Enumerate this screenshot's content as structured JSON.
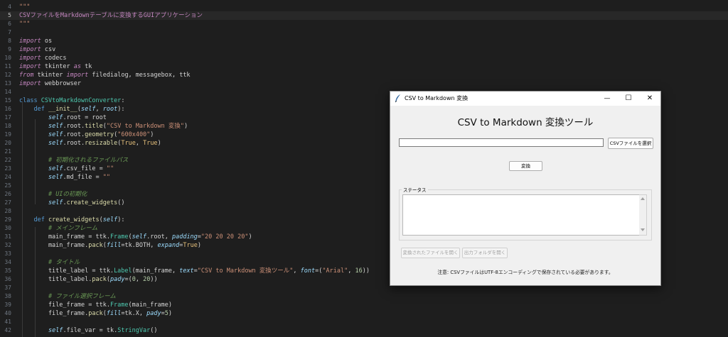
{
  "editor": {
    "lines": [
      {
        "n": "4",
        "html": "<span class='s'>\"\"\"</span>"
      },
      {
        "n": "5",
        "html": "<span class='d'>CSVファイルをMarkdownテーブルに変換するGUIアプリケーション</span>"
      },
      {
        "n": "6",
        "html": "<span class='s'>\"\"\"</span>"
      },
      {
        "n": "7",
        "html": ""
      },
      {
        "n": "8",
        "html": "<span class='k'>import</span><span class='t'> os</span>"
      },
      {
        "n": "9",
        "html": "<span class='k'>import</span><span class='t'> csv</span>"
      },
      {
        "n": "10",
        "html": "<span class='k'>import</span><span class='t'> codecs</span>"
      },
      {
        "n": "11",
        "html": "<span class='k'>import</span><span class='t'> tkinter </span><span class='k'>as</span><span class='t'> tk</span>"
      },
      {
        "n": "12",
        "html": "<span class='k'>from</span><span class='t'> tkinter </span><span class='k'>import</span><span class='t'> filedialog, messagebox, ttk</span>"
      },
      {
        "n": "13",
        "html": "<span class='k'>import</span><span class='t'> webbrowser</span>"
      },
      {
        "n": "14",
        "html": ""
      },
      {
        "n": "15",
        "html": "<span class='kw'>class</span><span class='t'> </span><span class='cl'>CSVtoMarkdownConverter</span><span class='t'>:</span>"
      },
      {
        "n": "16",
        "html": "<span class='t'>    </span><span class='kw'>def</span><span class='t'> </span><span class='f'>__init__</span><span class='t'>(</span><span class='p'>self</span><span class='t'>, </span><span class='p'>root</span><span class='t'>):</span>"
      },
      {
        "n": "17",
        "html": "<span class='t'>        </span><span class='p'>self</span><span class='t'>.root = root</span>"
      },
      {
        "n": "18",
        "html": "<span class='t'>        </span><span class='p'>self</span><span class='t'>.root.</span><span class='f'>title</span><span class='t'>(</span><span class='s'>\"CSV to Markdown 変換\"</span><span class='t'>)</span>"
      },
      {
        "n": "19",
        "html": "<span class='t'>        </span><span class='p'>self</span><span class='t'>.root.</span><span class='f'>geometry</span><span class='t'>(</span><span class='s'>\"600x400\"</span><span class='t'>)</span>"
      },
      {
        "n": "20",
        "html": "<span class='t'>        </span><span class='p'>self</span><span class='t'>.root.</span><span class='f'>resizable</span><span class='t'>(</span><span class='y'>True</span><span class='t'>, </span><span class='y'>True</span><span class='t'>)</span>"
      },
      {
        "n": "21",
        "html": ""
      },
      {
        "n": "22",
        "html": "<span class='t'>        </span><span class='c'># 初期化されるファイルパス</span>"
      },
      {
        "n": "23",
        "html": "<span class='t'>        </span><span class='p'>self</span><span class='t'>.csv_file = </span><span class='s'>\"\"</span>"
      },
      {
        "n": "24",
        "html": "<span class='t'>        </span><span class='p'>self</span><span class='t'>.md_file = </span><span class='s'>\"\"</span>"
      },
      {
        "n": "25",
        "html": ""
      },
      {
        "n": "26",
        "html": "<span class='t'>        </span><span class='c'># UIの初期化</span>"
      },
      {
        "n": "27",
        "html": "<span class='t'>        </span><span class='p'>self</span><span class='t'>.</span><span class='f'>create_widgets</span><span class='t'>()</span>"
      },
      {
        "n": "28",
        "html": ""
      },
      {
        "n": "29",
        "html": "<span class='t'>    </span><span class='kw'>def</span><span class='t'> </span><span class='f'>create_widgets</span><span class='t'>(</span><span class='p'>self</span><span class='t'>):</span>"
      },
      {
        "n": "30",
        "html": "<span class='t'>        </span><span class='c'># メインフレーム</span>"
      },
      {
        "n": "31",
        "html": "<span class='t'>        main_frame = ttk.</span><span class='cl'>Frame</span><span class='t'>(</span><span class='p'>self</span><span class='t'>.root, </span><span class='p'>padding</span><span class='t'>=</span><span class='s'>\"20 20 20 20\"</span><span class='t'>)</span>"
      },
      {
        "n": "32",
        "html": "<span class='t'>        main_frame.</span><span class='f'>pack</span><span class='t'>(</span><span class='p'>fill</span><span class='t'>=tk.BOTH, </span><span class='p'>expand</span><span class='t'>=</span><span class='y'>True</span><span class='t'>)</span>"
      },
      {
        "n": "33",
        "html": ""
      },
      {
        "n": "34",
        "html": "<span class='t'>        </span><span class='c'># タイトル</span>"
      },
      {
        "n": "35",
        "html": "<span class='t'>        title_label = ttk.</span><span class='cl'>Label</span><span class='t'>(main_frame, </span><span class='p'>text</span><span class='t'>=</span><span class='s'>\"CSV to Markdown 変換ツール\"</span><span class='t'>, </span><span class='p'>font</span><span class='t'>=(</span><span class='s'>\"Arial\"</span><span class='t'>, </span><span class='n'>16</span><span class='t'>))</span>"
      },
      {
        "n": "36",
        "html": "<span class='t'>        title_label.</span><span class='f'>pack</span><span class='t'>(</span><span class='p'>pady</span><span class='t'>=(</span><span class='n'>0</span><span class='t'>, </span><span class='n'>20</span><span class='t'>))</span>"
      },
      {
        "n": "37",
        "html": ""
      },
      {
        "n": "38",
        "html": "<span class='t'>        </span><span class='c'># ファイル選択フレーム</span>"
      },
      {
        "n": "39",
        "html": "<span class='t'>        file_frame = ttk.</span><span class='cl'>Frame</span><span class='t'>(main_frame)</span>"
      },
      {
        "n": "40",
        "html": "<span class='t'>        file_frame.</span><span class='f'>pack</span><span class='t'>(</span><span class='p'>fill</span><span class='t'>=tk.X, </span><span class='p'>pady</span><span class='t'>=</span><span class='n'>5</span><span class='t'>)</span>"
      },
      {
        "n": "41",
        "html": ""
      },
      {
        "n": "42",
        "html": "<span class='t'>        </span><span class='p'>self</span><span class='t'>.file_var = tk.</span><span class='cl'>StringVar</span><span class='t'>()</span>"
      }
    ],
    "active_line": "5"
  },
  "window": {
    "title": "CSV to Markdown 変換",
    "minimize_glyph": "—",
    "maximize_glyph": "☐",
    "close_glyph": "✕",
    "app_title": "CSV to Markdown 変換ツール",
    "file_value": "",
    "select_button": "CSVファイルを選択",
    "convert_button": "変換",
    "status_label": "ステータス",
    "status_text": "",
    "open_file_button": "変換されたファイルを開く",
    "open_folder_button": "出力フォルダを開く",
    "note": "注意: CSVファイルはUTF-8エンコーディングで保存されている必要があります。"
  },
  "colors": {
    "editor_bg": "#1e1e1e",
    "window_bg": "#f0f0f0"
  }
}
